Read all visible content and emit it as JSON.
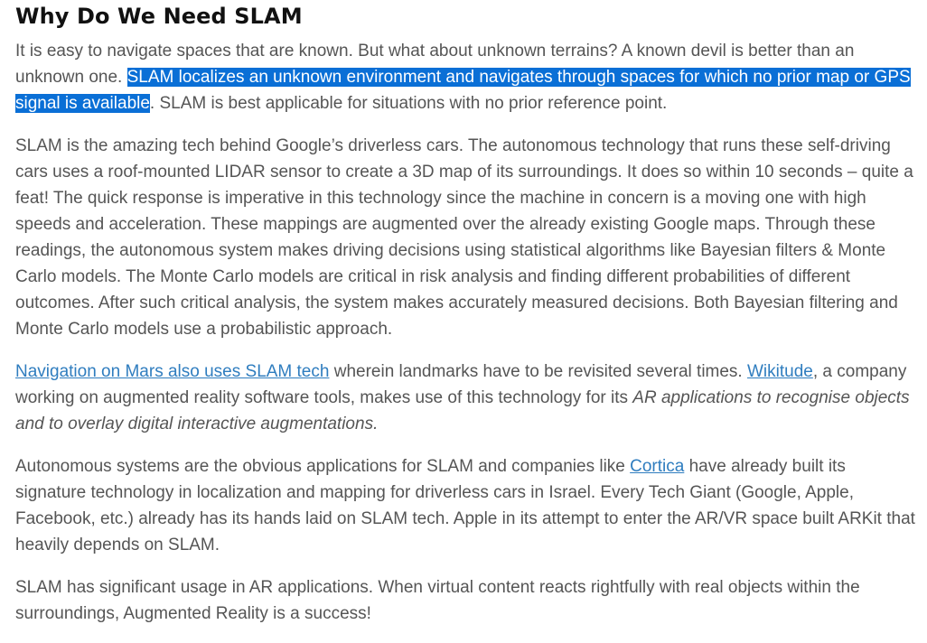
{
  "title": "Why Do We Need SLAM",
  "p1": {
    "before": "It is easy to navigate spaces that are known. But what about unknown terrains? A known devil is better than an unknown one. ",
    "highlighted": "SLAM localizes an unknown environment and navigates through spaces for which no prior map or GPS signal is available",
    "after": ". SLAM is best applicable for situations with no prior reference point."
  },
  "p2": "SLAM is the amazing tech behind Google’s driverless cars. The autonomous technology that runs these self-driving cars uses a roof-mounted LIDAR sensor to create a 3D map of its surroundings. It does so within 10 seconds – quite a feat! The quick response is imperative in this technology since the machine in concern is a moving one with high speeds and acceleration. These mappings are augmented over the already existing Google maps. Through these readings, the autonomous system makes driving decisions using statistical algorithms like Bayesian filters & Monte Carlo models. The Monte Carlo models are critical in risk analysis and finding different probabilities of different outcomes. After such critical analysis, the system makes accurately measured decisions. Both Bayesian filtering and Monte Carlo models use a probabilistic approach.",
  "p3": {
    "link1": "Navigation on Mars also uses SLAM tech",
    "text1": " wherein landmarks have to be revisited several times. ",
    "link2": "Wikitude",
    "text2": ", a company working on augmented reality software tools, makes use of this technology for its ",
    "italic": "AR applications to recognise objects and to overlay digital interactive augmentations."
  },
  "p4": {
    "text1": "Autonomous systems are the obvious applications for SLAM and companies like ",
    "link": "Cortica",
    "text2": " have already built its signature technology in localization and mapping for driverless cars in Israel. Every Tech Giant (Google, Apple, Facebook, etc.) already has its hands laid on SLAM tech. Apple in its attempt to enter the AR/VR space built ARKit that heavily depends on SLAM."
  },
  "p5": "SLAM has significant usage in AR applications. When virtual content reacts rightfully with real objects within the surroundings, Augmented Reality is a success!",
  "colors": {
    "highlight": "#0a6fd6",
    "link": "#2f7dbf",
    "body_text": "#555555",
    "heading": "#111111"
  }
}
